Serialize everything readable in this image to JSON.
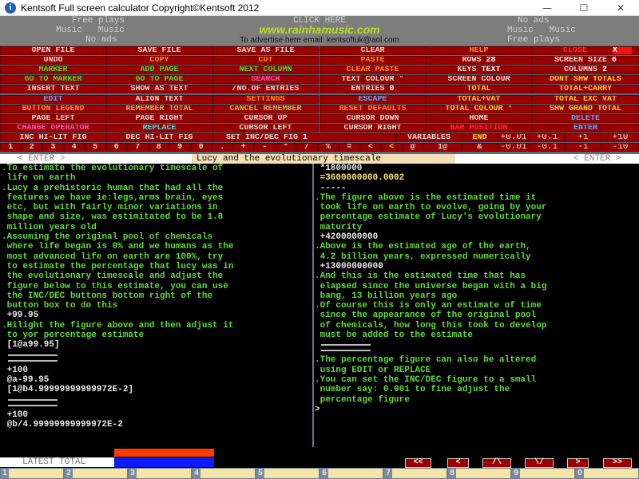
{
  "window": {
    "title": "Kentsoft Full screen calculator  Copyright©Kentsoft 2012",
    "minimize": "—",
    "maximize": "☐",
    "close": "✕"
  },
  "ad": {
    "left": [
      "Free plays",
      "Music   Music",
      "No ads"
    ],
    "click": "CLICK HERE",
    "url": "www.rainhamusic.com",
    "email": "To advertise here email: kentsoftuk@aol.com",
    "right": [
      "No ads",
      "Music   Music",
      "Free plays"
    ]
  },
  "buttons": {
    "rows": [
      [
        {
          "label": "OPEN FILE",
          "color": "white"
        },
        {
          "label": "SAVE FILE",
          "color": "white"
        },
        {
          "label": "SAVE AS FILE",
          "color": "white"
        },
        {
          "label": "CLEAR",
          "color": "white"
        },
        {
          "label": "HELP",
          "color": "orange"
        },
        {
          "label": "CLOSE",
          "color": "red",
          "extra": "X"
        }
      ],
      [
        {
          "label": "UNDO",
          "color": "lt"
        },
        {
          "label": "COPY",
          "color": "orange"
        },
        {
          "label": "CUT",
          "color": "orange"
        },
        {
          "label": "PASTE",
          "color": "orange"
        },
        {
          "label": "ROWS",
          "value": "28",
          "color": "lt"
        },
        {
          "label": "SCREEN SIZE",
          "value": "6",
          "color": "lt"
        }
      ],
      [
        {
          "label": "MARKER",
          "color": "green"
        },
        {
          "label": "ADD PAGE",
          "color": "green"
        },
        {
          "label": "NEXT COLUMN",
          "color": "green"
        },
        {
          "label": "CLEAR PASTE",
          "color": "orange"
        },
        {
          "label": "KEYS",
          "value": "TEXT",
          "color": "lt"
        },
        {
          "label": "COLUMNS",
          "value": "2",
          "color": "lt"
        }
      ],
      [
        {
          "label": "GO TO MARKER",
          "color": "green"
        },
        {
          "label": "GO TO PAGE",
          "color": "green"
        },
        {
          "label": "SEARCH",
          "color": "pink"
        },
        {
          "label": "TEXT COLOUR °",
          "color": "lt"
        },
        {
          "label": "SCREEN COLOUR",
          "color": "lt"
        },
        {
          "label": "DONT SHW TOTALS",
          "color": "yellow"
        }
      ],
      [
        {
          "label": "INSERT TEXT",
          "color": "lt"
        },
        {
          "label": "SHOW AS TEXT",
          "color": "lt"
        },
        {
          "label": "/NO.OF ENTRIES",
          "color": "lt"
        },
        {
          "label": "ENTRIES",
          "value": "0",
          "color": "lt"
        },
        {
          "label": "TOTAL",
          "color": "yellow"
        },
        {
          "label": "TOTAL+CARRY",
          "color": "yellow"
        }
      ],
      [
        {
          "label": "EDIT",
          "color": "blue"
        },
        {
          "label": "ALIGN TEXT",
          "color": "lt"
        },
        {
          "label": "SETTINGS",
          "color": "orange"
        },
        {
          "label": "ESCAPE",
          "color": "blue"
        },
        {
          "label": "TOTAL+VAT",
          "color": "yellow"
        },
        {
          "label": "TOTAL EXC VAT",
          "color": "yellow"
        }
      ],
      [
        {
          "label": "BUTTON LEGEND",
          "color": "orange"
        },
        {
          "label": "REMEMBER TOTAL",
          "color": "olive"
        },
        {
          "label": "CANCEL REMEMBER",
          "color": "olive"
        },
        {
          "label": "RESET DEFAULTS",
          "color": "orange"
        },
        {
          "label": "TOTAL COLOUR °",
          "color": "yellow"
        },
        {
          "label": "SHW GRAND TOTAL",
          "color": "yellow"
        }
      ],
      [
        {
          "label": "PAGE LEFT",
          "color": "lt"
        },
        {
          "label": "PAGE RIGHT",
          "color": "lt"
        },
        {
          "label": "CURSOR UP",
          "color": "lt"
        },
        {
          "label": "CURSOR DOWN",
          "color": "lt"
        },
        {
          "label": "HOME",
          "color": "lt"
        },
        {
          "label": "DELETE",
          "color": "blue"
        }
      ],
      [
        {
          "label": "CHANGE OPERATOR",
          "color": "pink"
        },
        {
          "label": "REPLACE",
          "color": "cyan"
        },
        {
          "label": "CURSOR LEFT",
          "color": "lt"
        },
        {
          "label": "CURSOR RIGHT",
          "color": "lt"
        },
        {
          "label": "BAR POSITION",
          "color": "red"
        },
        {
          "label": "ENTER",
          "color": "blue"
        }
      ]
    ],
    "inc_row": {
      "inc": "INC HI-LIT FIG",
      "dec": "DEC HI-LIT FIG",
      "set": "SET INC/DEC FIG",
      "set_value": "1",
      "variables": "VARIABLES",
      "end": "END",
      "plus": [
        "+0.01",
        "+0.1",
        "+1",
        "+10"
      ]
    },
    "keys_row": {
      "keys": [
        "1",
        "2",
        "3",
        "4",
        "5",
        "6",
        "7",
        "8",
        "9",
        "0",
        ".",
        "+",
        "-",
        "*",
        "/",
        "%",
        "=",
        "<",
        "<",
        "@",
        "1@",
        "&"
      ],
      "minus": [
        "-0.01",
        "-0.1",
        "-1",
        "-10"
      ]
    }
  },
  "strip": {
    "enter_left": "< ENTER >",
    "doc_title": "Lucy and the evolutionary timescale",
    "enter_right": "< ENTER >"
  },
  "left_pane": [
    {
      "t": ".To estimate the evolutionary timescale of",
      "c": "g"
    },
    {
      "t": " life on earth",
      "c": "g"
    },
    {
      "t": ".Lucy a prehistoric human that had all the",
      "c": "g"
    },
    {
      "t": " features we have ie:legs,arms brain, eyes",
      "c": "g"
    },
    {
      "t": " etc, but with fairly minor variations in",
      "c": "g"
    },
    {
      "t": " shape and size, was estimitated to be 1.8",
      "c": "g"
    },
    {
      "t": " million years old",
      "c": "g"
    },
    {
      "t": ".Assuming the original pool of chemicals",
      "c": "g"
    },
    {
      "t": " where life began is 0% and we humans as the",
      "c": "g"
    },
    {
      "t": " most advanced life on earth are 100%, try",
      "c": "g"
    },
    {
      "t": " to estimate the percentage that lucy was in",
      "c": "g"
    },
    {
      "t": " the evolutionary timescale and adjust the",
      "c": "g"
    },
    {
      "t": " figure below to this estimate, you can use",
      "c": "g"
    },
    {
      "t": " the INC/DEC buttons bottom right of the",
      "c": "g"
    },
    {
      "t": " button box to do this",
      "c": "g"
    },
    {
      "t": " +99.95",
      "c": "w"
    },
    {
      "t": ".Hilight the figure above and then adjust it",
      "c": "g"
    },
    {
      "t": " to yor percentage estimate",
      "c": "g"
    },
    {
      "t": " [1@a99.95]",
      "c": "w"
    },
    {
      "t": "",
      "c": "rule"
    },
    {
      "t": "",
      "c": "rule"
    },
    {
      "t": " +100",
      "c": "w"
    },
    {
      "t": " @a-99.95",
      "c": "w"
    },
    {
      "t": " [1@b4.99999999999972E-2]",
      "c": "w"
    },
    {
      "t": "",
      "c": "rule"
    },
    {
      "t": "",
      "c": "rule"
    },
    {
      "t": " +100",
      "c": "w"
    },
    {
      "t": " @b/4.99999999999972E-2",
      "c": "w"
    }
  ],
  "right_pane": [
    {
      "t": " *1800000",
      "c": "w"
    },
    {
      "t": " =3600000000.0002",
      "c": "y"
    },
    {
      "t": " -----",
      "c": "w"
    },
    {
      "t": ".The figure above is the estimated time it",
      "c": "g"
    },
    {
      "t": " took life on earth to evolve, going by your",
      "c": "g"
    },
    {
      "t": " percentage estimate of Lucy's evolutionary",
      "c": "g"
    },
    {
      "t": " maturity",
      "c": "g"
    },
    {
      "t": " +4200000000",
      "c": "w"
    },
    {
      "t": ".Above is the estimated age of the earth,",
      "c": "g"
    },
    {
      "t": " 4.2 billion years, expressed numerically",
      "c": "g"
    },
    {
      "t": " +13000000000",
      "c": "w"
    },
    {
      "t": ".And this is the estimated time that has",
      "c": "g"
    },
    {
      "t": " elapsed since the universe began with a big",
      "c": "g"
    },
    {
      "t": " bang, 13 billion years ago",
      "c": "g"
    },
    {
      "t": ".Of course this is only an estimate of time",
      "c": "g"
    },
    {
      "t": " since the appearance of the original pool",
      "c": "g"
    },
    {
      "t": " of chemicals, how long this took to develop",
      "c": "g"
    },
    {
      "t": " must be added to the estimate",
      "c": "g"
    },
    {
      "t": "",
      "c": "rule"
    },
    {
      "t": "",
      "c": "rule"
    },
    {
      "t": ".The percentage figure can also be altered",
      "c": "g"
    },
    {
      "t": " using EDIT or REPLACE",
      "c": "g"
    },
    {
      "t": ".You can set the INC/DEC figure to a small",
      "c": "g"
    },
    {
      "t": " number say: 0.001 to fine adjust the",
      "c": "g"
    },
    {
      "t": " percentage figure",
      "c": "g"
    },
    {
      "t": ">",
      "c": "cursor"
    }
  ],
  "bottom": {
    "latest_total": "LATEST TOTAL",
    "nav": [
      "<<",
      "<",
      "/\\",
      "\\/",
      ">",
      ">>"
    ],
    "page_tabs": [
      "1",
      "2",
      "3",
      "4",
      "5",
      "6",
      "7",
      "8",
      "9",
      "0"
    ]
  }
}
